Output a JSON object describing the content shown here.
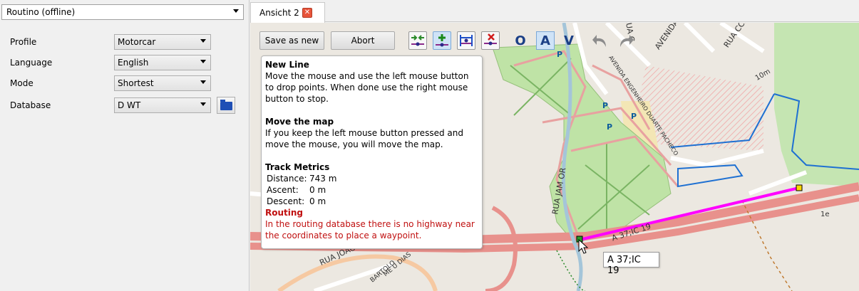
{
  "left_panel": {
    "source": "Routino (offline)",
    "fields": [
      {
        "label": "Profile",
        "value": "Motorcar"
      },
      {
        "label": "Language",
        "value": "English"
      },
      {
        "label": "Mode",
        "value": "Shortest"
      },
      {
        "label": "Database",
        "value": "D WT"
      }
    ]
  },
  "tab": {
    "label": "Ansicht 2",
    "close_glyph": "✕"
  },
  "toolbar": {
    "save_label": "Save as new",
    "abort_label": "Abort",
    "letters": [
      "O",
      "A",
      "V"
    ],
    "icons": [
      "move-points-icon",
      "add-point-icon",
      "insert-point-icon",
      "delete-point-icon",
      "undo-icon",
      "redo-icon"
    ]
  },
  "help": {
    "new_line_title": "New Line",
    "new_line_text": "Move the mouse and use the left mouse button to drop points. When done use the right mouse button to stop.",
    "move_map_title": "Move the map",
    "move_map_text": "If you keep the left mouse button pressed and move the mouse, you will move the map.",
    "metrics_title": "Track Metrics",
    "metrics": [
      {
        "label": "Distance:",
        "value": "743 m"
      },
      {
        "label": "Ascent:",
        "value": "0 m"
      },
      {
        "label": "Descent:",
        "value": "0 m"
      }
    ],
    "routing_title": "Routing",
    "routing_text": "In the routing database there is no highway near the coordinates to place a waypoint."
  },
  "map": {
    "tooltip": "A 37;IC 19",
    "labels": {
      "avenida": "AVENIDA",
      "rua_c": "RUA C",
      "rua": "RUA CCM",
      "avenida_eng": "AVENIDA ENGENHEIRO DUARTE PACHECO",
      "parking": "P",
      "road_a37": "A 37;IC 19",
      "road_r": "R",
      "rua_joao": "RUA JOÃO II",
      "bartolo": "BARTOLO",
      "me_u_dias": "ME U DIAS",
      "jam_or": "RUA JAM OR",
      "ten_m": "10m",
      "one_e": "1e"
    },
    "colors": {
      "route": "#ff00ff",
      "waterway": "#1e70d2",
      "park": "#b9e29c",
      "highway": "#e08a86"
    }
  }
}
